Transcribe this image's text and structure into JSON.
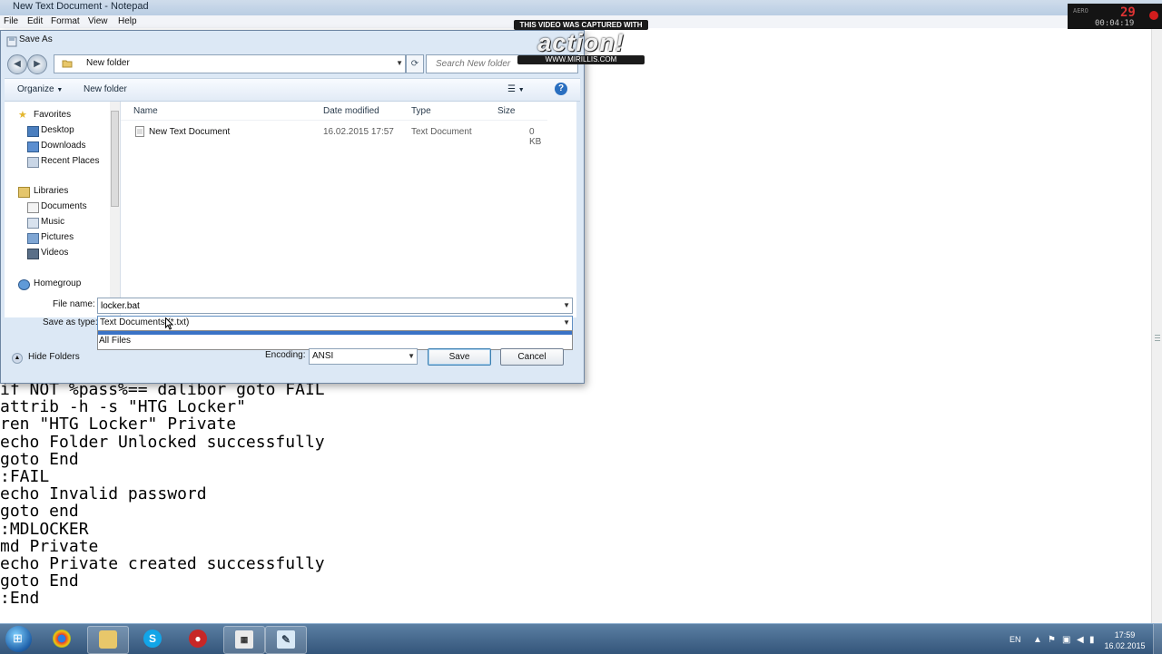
{
  "notepad": {
    "title": "New Text Document - Notepad",
    "menu": [
      "File",
      "Edit",
      "Format",
      "View",
      "Help"
    ],
    "lines": [
      "if NOT %pass%== dalibor goto FAIL",
      "attrib -h -s \"HTG Locker\"",
      "ren \"HTG Locker\" Private",
      "echo Folder Unlocked successfully",
      "goto End",
      ":FAIL",
      "echo Invalid password",
      "goto end",
      ":MDLOCKER",
      "md Private",
      "echo Private created successfully",
      "goto End",
      ":End"
    ]
  },
  "watermark": {
    "top": "THIS VIDEO WAS CAPTURED WITH",
    "logo": "action!",
    "url": "WWW.MIRILLIS.COM"
  },
  "overlay": {
    "tag": "AERO",
    "fps": "29",
    "time": "00:04:19"
  },
  "dialog": {
    "title": "Save As",
    "address": "New folder",
    "search_placeholder": "Search New folder",
    "toolbar": {
      "organize": "Organize",
      "new_folder": "New folder"
    },
    "nav": {
      "favorites": "Favorites",
      "desktop": "Desktop",
      "downloads": "Downloads",
      "recent": "Recent Places",
      "libraries": "Libraries",
      "documents": "Documents",
      "music": "Music",
      "pictures": "Pictures",
      "videos": "Videos",
      "homegroup": "Homegroup"
    },
    "columns": {
      "name": "Name",
      "date": "Date modified",
      "type": "Type",
      "size": "Size"
    },
    "file": {
      "name": "New Text Document",
      "date": "16.02.2015 17:57",
      "type": "Text Document",
      "size": "0 KB"
    },
    "file_name_label": "File name:",
    "file_name_value": "locker.bat",
    "save_type_label": "Save as type:",
    "save_type_value": "Text Documents (*.txt)",
    "save_type_options": [
      "Text Documents (*.txt)",
      "All Files"
    ],
    "hide_folders": "Hide Folders",
    "encoding_label": "Encoding:",
    "encoding_value": "ANSI",
    "save_label": "Save",
    "cancel_label": "Cancel"
  },
  "taskbar": {
    "lang": "EN",
    "time": "17:59",
    "date": "16.02.2015"
  },
  "colors": {
    "dialog_bg": "#dce8f5",
    "selection": "#3a73c6",
    "taskbar": "#34557a",
    "record": "#d21d1d"
  }
}
